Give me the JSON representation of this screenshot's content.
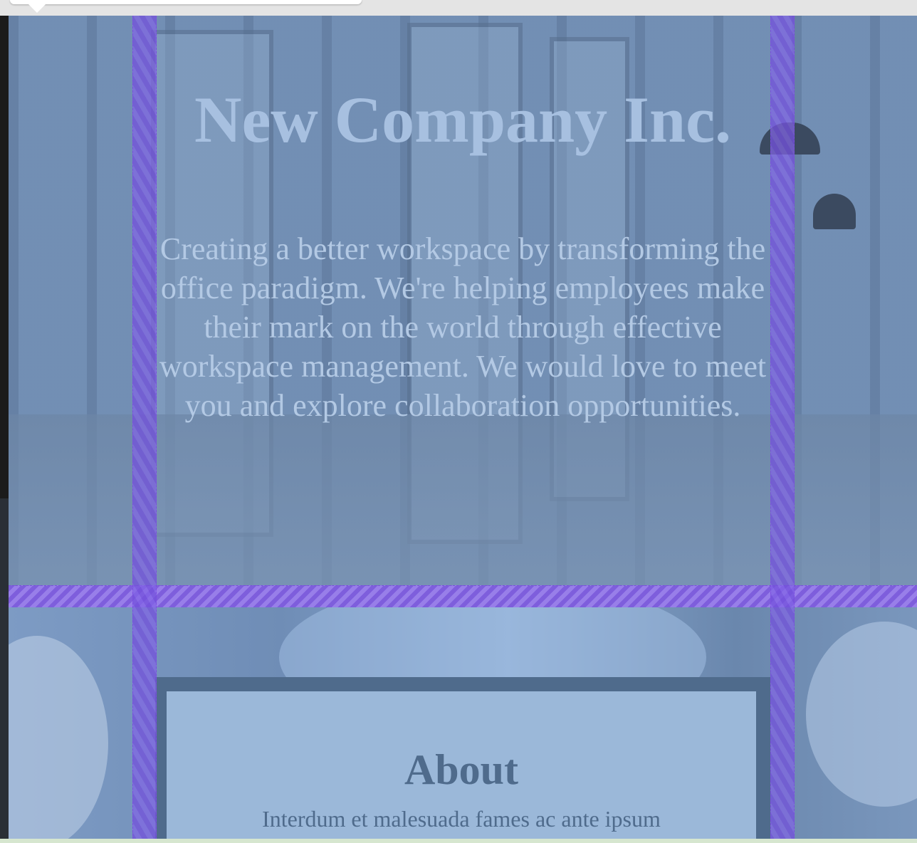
{
  "hero": {
    "title": "New Company Inc.",
    "tagline": "Creating a better workspace by transforming the office paradigm. We're helping employees make their mark on the world through effective workspace management. We would love to meet you and explore collaboration opportunities."
  },
  "about": {
    "heading": "About",
    "body": "Interdum et malesuada fames ac ante ipsum"
  },
  "colors": {
    "title": "#a7c0e0",
    "text": "#b3c9e4",
    "card_bg": "#9bb8d9",
    "card_frame": "#4f6b8c",
    "grid_overlay": "#7b4de0"
  }
}
